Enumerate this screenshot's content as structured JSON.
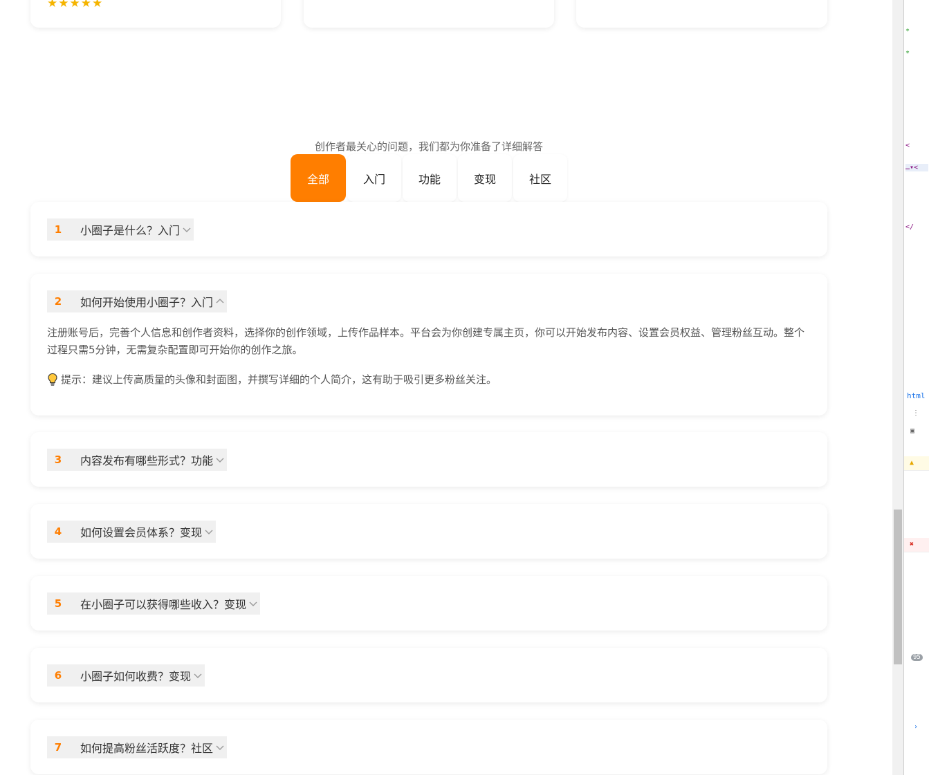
{
  "top_cards": {
    "stars": "★★★★★"
  },
  "subtitle": "创作者最关心的问题，我们都为你准备了详细解答",
  "tabs": [
    {
      "label": "全部",
      "active": true
    },
    {
      "label": "入门"
    },
    {
      "label": "功能"
    },
    {
      "label": "变现"
    },
    {
      "label": "社区"
    }
  ],
  "faqs": [
    {
      "num": "1",
      "question": "小圈子是什么？入门",
      "expanded": false
    },
    {
      "num": "2",
      "question": "如何开始使用小圈子？入门",
      "expanded": true,
      "answer": "注册账号后，完善个人信息和创作者资料，选择你的创作领域，上传作品样本。平台会为你创建专属主页，你可以开始发布内容、设置会员权益、管理粉丝互动。整个过程只需5分钟，无需复杂配置即可开始你的创作之旅。",
      "tip": "提示：建议上传高质量的头像和封面图，并撰写详细的个人简介，这有助于吸引更多粉丝关注。"
    },
    {
      "num": "3",
      "question": "内容发布有哪些形式？功能",
      "expanded": false
    },
    {
      "num": "4",
      "question": "如何设置会员体系？变现",
      "expanded": false
    },
    {
      "num": "5",
      "question": "在小圈子可以获得哪些收入？变现",
      "expanded": false
    },
    {
      "num": "6",
      "question": "小圈子如何收费？变现",
      "expanded": false
    },
    {
      "num": "7",
      "question": "如何提高粉丝活跃度？社区",
      "expanded": false
    }
  ],
  "devtools": {
    "html_tab": "html",
    "badge": "95"
  },
  "colors": {
    "accent": "#ff7e00",
    "star": "#f5b400"
  },
  "icons": [
    "chevron-down-icon",
    "chevron-up-icon",
    "lightbulb-icon",
    "star-icon"
  ]
}
